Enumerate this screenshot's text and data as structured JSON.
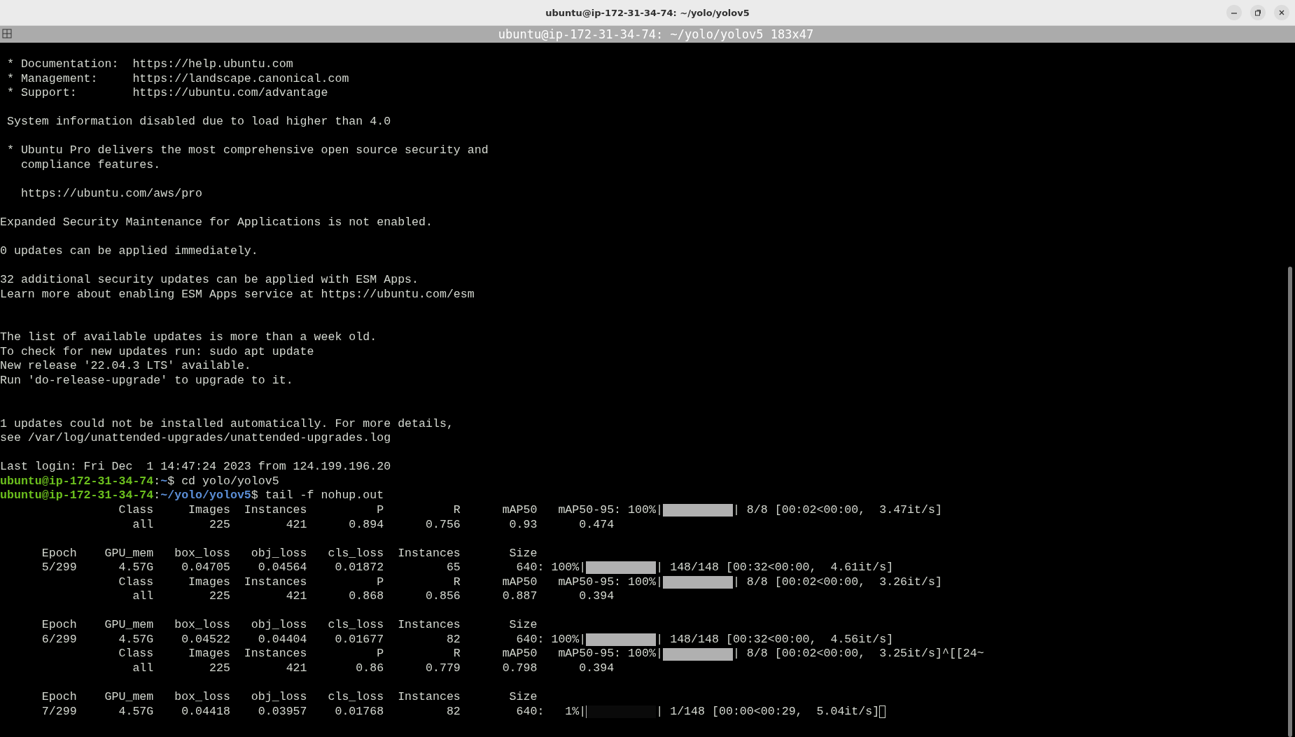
{
  "window": {
    "title": "ubuntu@ip-172-31-34-74: ~/yolo/yolov5"
  },
  "tab_bar": {
    "title": "ubuntu@ip-172-31-34-74: ~/yolo/yolov5 183x47"
  },
  "terminal": {
    "lines": [
      {
        "kind": "text",
        "text": " * Documentation:  https://help.ubuntu.com"
      },
      {
        "kind": "text",
        "text": " * Management:     https://landscape.canonical.com"
      },
      {
        "kind": "text",
        "text": " * Support:        https://ubuntu.com/advantage"
      },
      {
        "kind": "blank"
      },
      {
        "kind": "text",
        "text": " System information disabled due to load higher than 4.0"
      },
      {
        "kind": "blank"
      },
      {
        "kind": "text",
        "text": " * Ubuntu Pro delivers the most comprehensive open source security and"
      },
      {
        "kind": "text",
        "text": "   compliance features."
      },
      {
        "kind": "blank"
      },
      {
        "kind": "text",
        "text": "   https://ubuntu.com/aws/pro"
      },
      {
        "kind": "blank"
      },
      {
        "kind": "text",
        "text": "Expanded Security Maintenance for Applications is not enabled."
      },
      {
        "kind": "blank"
      },
      {
        "kind": "text",
        "text": "0 updates can be applied immediately."
      },
      {
        "kind": "blank"
      },
      {
        "kind": "text",
        "text": "32 additional security updates can be applied with ESM Apps."
      },
      {
        "kind": "text",
        "text": "Learn more about enabling ESM Apps service at https://ubuntu.com/esm"
      },
      {
        "kind": "blank"
      },
      {
        "kind": "blank"
      },
      {
        "kind": "text",
        "text": "The list of available updates is more than a week old."
      },
      {
        "kind": "text",
        "text": "To check for new updates run: sudo apt update"
      },
      {
        "kind": "text",
        "text": "New release '22.04.3 LTS' available."
      },
      {
        "kind": "text",
        "text": "Run 'do-release-upgrade' to upgrade to it."
      },
      {
        "kind": "blank"
      },
      {
        "kind": "blank"
      },
      {
        "kind": "text",
        "text": "1 updates could not be installed automatically. For more details,"
      },
      {
        "kind": "text",
        "text": "see /var/log/unattended-upgrades/unattended-upgrades.log"
      },
      {
        "kind": "blank"
      },
      {
        "kind": "text",
        "text": "Last login: Fri Dec  1 14:47:24 2023 from 124.199.196.20"
      },
      {
        "kind": "prompt",
        "host": "ubuntu@ip-172-31-34-74",
        "separator": ":",
        "path": "~",
        "command": "$ cd yolo/yolov5"
      },
      {
        "kind": "prompt",
        "host": "ubuntu@ip-172-31-34-74",
        "separator": ":",
        "path": "~/yolo/yolov5",
        "command": "$ tail -f nohup.out"
      },
      {
        "kind": "progress",
        "prefix": "                 Class     Images  Instances          P          R      mAP50   mAP50-95: 100%|",
        "level": 1,
        "suffix": "| 8/8 [00:02<00:00,  3.47it/s]",
        "cursor": false
      },
      {
        "kind": "text",
        "text": "                   all        225        421      0.894      0.756       0.93      0.474"
      },
      {
        "kind": "blank"
      },
      {
        "kind": "text",
        "text": "      Epoch    GPU_mem   box_loss   obj_loss   cls_loss  Instances       Size"
      },
      {
        "kind": "progress",
        "prefix": "      5/299      4.57G    0.04705    0.04564    0.01872         65        640: 100%|",
        "level": 1,
        "suffix": "| 148/148 [00:32<00:00,  4.61it/s]",
        "cursor": false
      },
      {
        "kind": "progress",
        "prefix": "                 Class     Images  Instances          P          R      mAP50   mAP50-95: 100%|",
        "level": 1,
        "suffix": "| 8/8 [00:02<00:00,  3.26it/s]",
        "cursor": false
      },
      {
        "kind": "text",
        "text": "                   all        225        421      0.868      0.856      0.887      0.394"
      },
      {
        "kind": "blank"
      },
      {
        "kind": "text",
        "text": "      Epoch    GPU_mem   box_loss   obj_loss   cls_loss  Instances       Size"
      },
      {
        "kind": "progress",
        "prefix": "      6/299      4.57G    0.04522    0.04404    0.01677         82        640: 100%|",
        "level": 1,
        "suffix": "| 148/148 [00:32<00:00,  4.56it/s]",
        "cursor": false
      },
      {
        "kind": "progress",
        "prefix": "                 Class     Images  Instances          P          R      mAP50   mAP50-95: 100%|",
        "level": 1,
        "suffix": "| 8/8 [00:02<00:00,  3.25it/s]^[[24~",
        "cursor": false
      },
      {
        "kind": "text",
        "text": "                   all        225        421       0.86      0.779      0.798      0.394"
      },
      {
        "kind": "blank"
      },
      {
        "kind": "text",
        "text": "      Epoch    GPU_mem   box_loss   obj_loss   cls_loss  Instances       Size"
      },
      {
        "kind": "progress",
        "prefix": "      7/299      4.57G    0.04418    0.03957    0.01768         82        640:   1%|",
        "level": 0.01,
        "suffix": "| 1/148 [00:00<00:29,  5.04it/s]",
        "cursor": true
      }
    ]
  }
}
